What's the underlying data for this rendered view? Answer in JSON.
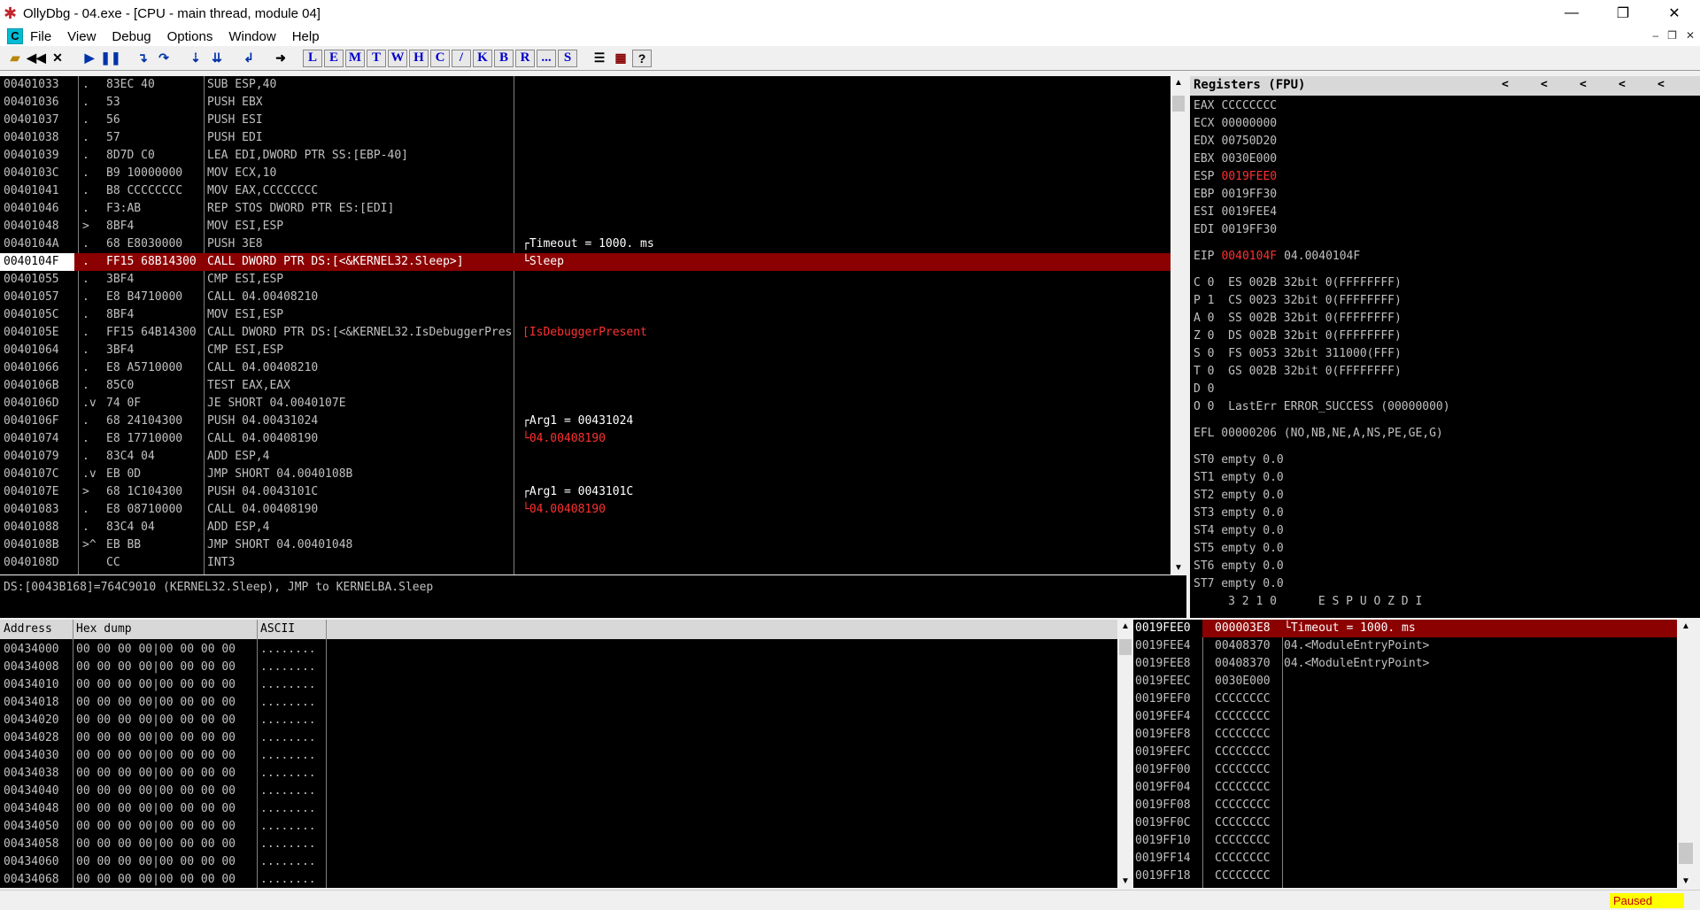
{
  "window": {
    "title": "OllyDbg - 04.exe - [CPU - main thread, module 04]",
    "controls": [
      "—",
      "❐",
      "✕"
    ]
  },
  "menu": {
    "items": [
      "File",
      "View",
      "Debug",
      "Options",
      "Window",
      "Help"
    ],
    "mdi_controls": [
      "–",
      "❐",
      "✕"
    ]
  },
  "toolbar": {
    "letters": [
      "L",
      "E",
      "M",
      "T",
      "W",
      "H",
      "C",
      "/",
      "K",
      "B",
      "R",
      "...",
      "S"
    ],
    "help": "?"
  },
  "disasm": {
    "rows": [
      {
        "addr": "00401033",
        "mark": ".",
        "hex": "83EC 40",
        "ins": "SUB ESP,40",
        "cmt": ""
      },
      {
        "addr": "00401036",
        "mark": ".",
        "hex": "53",
        "ins": "PUSH EBX",
        "cmt": ""
      },
      {
        "addr": "00401037",
        "mark": ".",
        "hex": "56",
        "ins": "PUSH ESI",
        "cmt": ""
      },
      {
        "addr": "00401038",
        "mark": ".",
        "hex": "57",
        "ins": "PUSH EDI",
        "cmt": ""
      },
      {
        "addr": "00401039",
        "mark": ".",
        "hex": "8D7D C0",
        "ins": "LEA EDI,DWORD PTR SS:[EBP-40]",
        "cmt": ""
      },
      {
        "addr": "0040103C",
        "mark": ".",
        "hex": "B9 10000000",
        "ins": "MOV ECX,10",
        "cmt": ""
      },
      {
        "addr": "00401041",
        "mark": ".",
        "hex": "B8 CCCCCCCC",
        "ins": "MOV EAX,CCCCCCCC",
        "cmt": ""
      },
      {
        "addr": "00401046",
        "mark": ".",
        "hex": "F3:AB",
        "ins": "REP STOS DWORD PTR ES:[EDI]",
        "cmt": ""
      },
      {
        "addr": "00401048",
        "mark": ">",
        "hex": "8BF4",
        "ins": "MOV ESI,ESP",
        "cmt": ""
      },
      {
        "addr": "0040104A",
        "mark": ".",
        "hex": "68 E8030000",
        "ins": "PUSH 3E8",
        "cmt": "┌Timeout = 1000. ms"
      },
      {
        "addr": "0040104F",
        "mark": ".",
        "hex": "FF15 68B14300",
        "ins": "CALL DWORD PTR DS:[<&KERNEL32.Sleep>]",
        "cmt": "└Sleep",
        "selected": true
      },
      {
        "addr": "00401055",
        "mark": ".",
        "hex": "3BF4",
        "ins": "CMP ESI,ESP",
        "cmt": ""
      },
      {
        "addr": "00401057",
        "mark": ".",
        "hex": "E8 B4710000",
        "ins": "CALL 04.00408210",
        "cmt": ""
      },
      {
        "addr": "0040105C",
        "mark": ".",
        "hex": "8BF4",
        "ins": "MOV ESI,ESP",
        "cmt": ""
      },
      {
        "addr": "0040105E",
        "mark": ".",
        "hex": "FF15 64B14300",
        "ins": "CALL DWORD PTR DS:[<&KERNEL32.IsDebuggerPresent>]",
        "cmt": "[IsDebuggerPresent",
        "cmtred": true
      },
      {
        "addr": "00401064",
        "mark": ".",
        "hex": "3BF4",
        "ins": "CMP ESI,ESP",
        "cmt": ""
      },
      {
        "addr": "00401066",
        "mark": ".",
        "hex": "E8 A5710000",
        "ins": "CALL 04.00408210",
        "cmt": ""
      },
      {
        "addr": "0040106B",
        "mark": ".",
        "hex": "85C0",
        "ins": "TEST EAX,EAX",
        "cmt": ""
      },
      {
        "addr": "0040106D",
        "mark": ".v",
        "hex": "74 0F",
        "ins": "JE SHORT 04.0040107E",
        "cmt": ""
      },
      {
        "addr": "0040106F",
        "mark": ".",
        "hex": "68 24104300",
        "ins": "PUSH 04.00431024",
        "cmt": "┌Arg1 = 00431024"
      },
      {
        "addr": "00401074",
        "mark": ".",
        "hex": "E8 17710000",
        "ins": "CALL 04.00408190",
        "cmt": "└04.00408190",
        "cmtred": true
      },
      {
        "addr": "00401079",
        "mark": ".",
        "hex": "83C4 04",
        "ins": "ADD ESP,4",
        "cmt": ""
      },
      {
        "addr": "0040107C",
        "mark": ".v",
        "hex": "EB 0D",
        "ins": "JMP SHORT 04.0040108B",
        "cmt": ""
      },
      {
        "addr": "0040107E",
        "mark": ">",
        "hex": "68 1C104300",
        "ins": "PUSH 04.0043101C",
        "cmt": "┌Arg1 = 0043101C"
      },
      {
        "addr": "00401083",
        "mark": ".",
        "hex": "E8 08710000",
        "ins": "CALL 04.00408190",
        "cmt": "└04.00408190",
        "cmtred": true
      },
      {
        "addr": "00401088",
        "mark": ".",
        "hex": "83C4 04",
        "ins": "ADD ESP,4",
        "cmt": ""
      },
      {
        "addr": "0040108B",
        "mark": ">^",
        "hex": "EB BB",
        "ins": "JMP SHORT 04.00401048",
        "cmt": ""
      },
      {
        "addr": "0040108D",
        "mark": "",
        "hex": "CC",
        "ins": "INT3",
        "cmt": ""
      }
    ]
  },
  "info_line": "DS:[0043B168]=764C9010 (KERNEL32.Sleep), JMP to KERNELBA.Sleep",
  "registers": {
    "header": "Registers (FPU)",
    "nav": [
      "<",
      "<",
      "<",
      "<",
      "<"
    ],
    "general": [
      {
        "name": "EAX",
        "value": "CCCCCCCC"
      },
      {
        "name": "ECX",
        "value": "00000000"
      },
      {
        "name": "EDX",
        "value": "00750D20"
      },
      {
        "name": "EBX",
        "value": "0030E000"
      },
      {
        "name": "ESP",
        "value": "0019FEE0",
        "changed": true
      },
      {
        "name": "EBP",
        "value": "0019FF30"
      },
      {
        "name": "ESI",
        "value": "0019FEE4"
      },
      {
        "name": "EDI",
        "value": "0019FF30"
      }
    ],
    "eip": {
      "name": "EIP",
      "value": "0040104F",
      "extra": "04.0040104F"
    },
    "flags": [
      "C 0  ES 002B 32bit 0(FFFFFFFF)",
      "P 1  CS 0023 32bit 0(FFFFFFFF)",
      "A 0  SS 002B 32bit 0(FFFFFFFF)",
      "Z 0  DS 002B 32bit 0(FFFFFFFF)",
      "S 0  FS 0053 32bit 311000(FFF)",
      "T 0  GS 002B 32bit 0(FFFFFFFF)",
      "D 0",
      "O 0  LastErr ERROR_SUCCESS (00000000)"
    ],
    "efl": "EFL 00000206 (NO,NB,NE,A,NS,PE,GE,G)",
    "fpu": [
      "ST0 empty 0.0",
      "ST1 empty 0.0",
      "ST2 empty 0.0",
      "ST3 empty 0.0",
      "ST4 empty 0.0",
      "ST5 empty 0.0",
      "ST6 empty 0.0",
      "ST7 empty 0.0"
    ],
    "fpu_footer": "     3 2 1 0      E S P U O Z D I"
  },
  "dump": {
    "headers": [
      "Address",
      "Hex dump",
      "ASCII"
    ],
    "rows": [
      {
        "addr": "00434000",
        "hex": "00 00 00 00|00 00 00 00",
        "ascii": "........"
      },
      {
        "addr": "00434008",
        "hex": "00 00 00 00|00 00 00 00",
        "ascii": "........"
      },
      {
        "addr": "00434010",
        "hex": "00 00 00 00|00 00 00 00",
        "ascii": "........"
      },
      {
        "addr": "00434018",
        "hex": "00 00 00 00|00 00 00 00",
        "ascii": "........"
      },
      {
        "addr": "00434020",
        "hex": "00 00 00 00|00 00 00 00",
        "ascii": "........"
      },
      {
        "addr": "00434028",
        "hex": "00 00 00 00|00 00 00 00",
        "ascii": "........"
      },
      {
        "addr": "00434030",
        "hex": "00 00 00 00|00 00 00 00",
        "ascii": "........"
      },
      {
        "addr": "00434038",
        "hex": "00 00 00 00|00 00 00 00",
        "ascii": "........"
      },
      {
        "addr": "00434040",
        "hex": "00 00 00 00|00 00 00 00",
        "ascii": "........"
      },
      {
        "addr": "00434048",
        "hex": "00 00 00 00|00 00 00 00",
        "ascii": "........"
      },
      {
        "addr": "00434050",
        "hex": "00 00 00 00|00 00 00 00",
        "ascii": "........"
      },
      {
        "addr": "00434058",
        "hex": "00 00 00 00|00 00 00 00",
        "ascii": "........"
      },
      {
        "addr": "00434060",
        "hex": "00 00 00 00|00 00 00 00",
        "ascii": "........"
      },
      {
        "addr": "00434068",
        "hex": "00 00 00 00|00 00 00 00",
        "ascii": "........"
      }
    ]
  },
  "stack": {
    "rows": [
      {
        "addr": "0019FEE0",
        "val": "000003E8",
        "cmt": "└Timeout = 1000. ms",
        "selected": true
      },
      {
        "addr": "0019FEE4",
        "val": "00408370",
        "cmt": "04.<ModuleEntryPoint>"
      },
      {
        "addr": "0019FEE8",
        "val": "00408370",
        "cmt": "04.<ModuleEntryPoint>"
      },
      {
        "addr": "0019FEEC",
        "val": "0030E000",
        "cmt": ""
      },
      {
        "addr": "0019FEF0",
        "val": "CCCCCCCC",
        "cmt": ""
      },
      {
        "addr": "0019FEF4",
        "val": "CCCCCCCC",
        "cmt": ""
      },
      {
        "addr": "0019FEF8",
        "val": "CCCCCCCC",
        "cmt": ""
      },
      {
        "addr": "0019FEFC",
        "val": "CCCCCCCC",
        "cmt": ""
      },
      {
        "addr": "0019FF00",
        "val": "CCCCCCCC",
        "cmt": ""
      },
      {
        "addr": "0019FF04",
        "val": "CCCCCCCC",
        "cmt": ""
      },
      {
        "addr": "0019FF08",
        "val": "CCCCCCCC",
        "cmt": ""
      },
      {
        "addr": "0019FF0C",
        "val": "CCCCCCCC",
        "cmt": ""
      },
      {
        "addr": "0019FF10",
        "val": "CCCCCCCC",
        "cmt": ""
      },
      {
        "addr": "0019FF14",
        "val": "CCCCCCCC",
        "cmt": ""
      },
      {
        "addr": "0019FF18",
        "val": "CCCCCCCC",
        "cmt": ""
      }
    ]
  },
  "status": {
    "state": "Paused"
  },
  "colors": {
    "selected_row": "#8b0000",
    "changed_reg": "#ff3030",
    "paused_bg": "#ffff00"
  }
}
